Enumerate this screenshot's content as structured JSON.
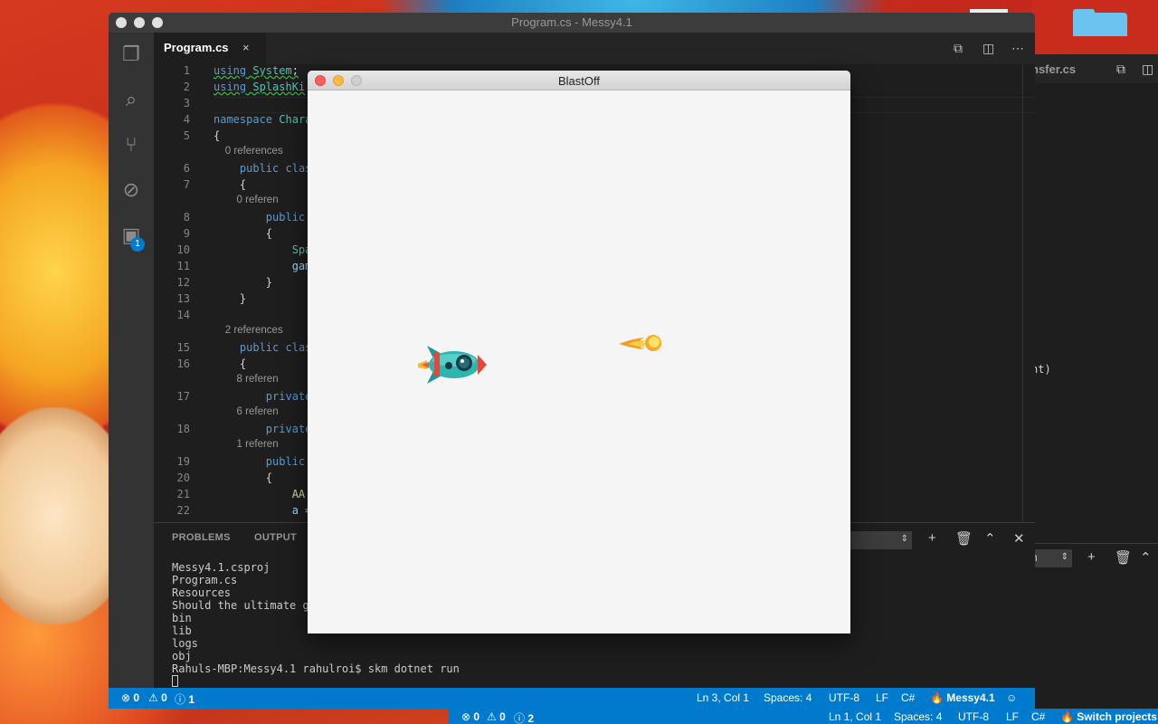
{
  "main_window": {
    "title": "Program.cs - Messy4.1",
    "tab": {
      "label": "Program.cs",
      "close": "×"
    },
    "activity_badge": "1",
    "code_lines": [
      {
        "num": "1",
        "html": "<span class=\"kw squig\">using</span><span class=\"squig\"> </span><span class=\"ty squig\">System</span><span class=\"squig\">;</span>"
      },
      {
        "num": "2",
        "html": "<span class=\"kw squig\">using</span><span class=\"squig\"> </span><span class=\"ty squig\">SplashKi</span>"
      },
      {
        "num": "3",
        "html": ""
      },
      {
        "num": "4",
        "html": "<span class=\"kw\">namespace</span> <span class=\"ty\">Chara</span>"
      },
      {
        "num": "5",
        "html": "{"
      },
      {
        "lens": true,
        "text": "    0 references"
      },
      {
        "num": "6",
        "html": "    <span class=\"kw\">public</span> <span class=\"kw\">clas</span>"
      },
      {
        "num": "7",
        "html": "    {"
      },
      {
        "lens": true,
        "text": "        0 referen"
      },
      {
        "num": "8",
        "html": "        <span class=\"kw\">public</span>"
      },
      {
        "num": "9",
        "html": "        {"
      },
      {
        "num": "10",
        "html": "            <span class=\"ty\">Spa</span>"
      },
      {
        "num": "11",
        "html": "            <span class=\"var\">gam</span>"
      },
      {
        "num": "12",
        "html": "        }"
      },
      {
        "num": "13",
        "html": "    }"
      },
      {
        "num": "14",
        "html": ""
      },
      {
        "lens": true,
        "text": "    2 references"
      },
      {
        "num": "15",
        "html": "    <span class=\"kw\">public</span> <span class=\"kw\">clas</span>"
      },
      {
        "num": "16",
        "html": "    {"
      },
      {
        "lens": true,
        "text": "        8 referen"
      },
      {
        "num": "17",
        "html": "        <span class=\"kw\">private</span>"
      },
      {
        "lens": true,
        "text": "        6 referen"
      },
      {
        "num": "18",
        "html": "        <span class=\"kw\">private</span>"
      },
      {
        "lens": true,
        "text": "        1 referen"
      },
      {
        "num": "19",
        "html": "        <span class=\"kw\">public</span>"
      },
      {
        "num": "20",
        "html": "        {"
      },
      {
        "num": "21",
        "html": "            <span class=\"fn\">AA</span>"
      },
      {
        "num": "22",
        "html": "            <span class=\"var\">a</span> ="
      }
    ],
    "panel": {
      "tabs": [
        "PROBLEMS",
        "OUTPUT"
      ],
      "terminal_lines": [
        "Messy4.1.csproj",
        "Program.cs",
        "Resources",
        "Should the ultimate g",
        "bin",
        "lib",
        "logs",
        "obj",
        "Rahuls-MBP:Messy4.1 rahulroi$ skm dotnet run"
      ]
    },
    "status": {
      "errors": "0",
      "warnings": "0",
      "info": "1",
      "position": "Ln 3, Col 1",
      "spaces": "Spaces: 4",
      "encoding": "UTF-8",
      "eol": "LF",
      "language": "C#",
      "project": "Messy4.1"
    }
  },
  "back_window": {
    "tab_label": "nsfer.cs",
    "code_fragment": "nt)",
    "select_label": "sh",
    "status": {
      "errors": "0",
      "warnings": "0",
      "info": "2",
      "position": "Ln 1, Col 1",
      "spaces": "Spaces: 4",
      "encoding": "UTF-8",
      "eol": "LF",
      "language": "C#",
      "switch": "Switch projects"
    }
  },
  "game_window": {
    "title": "BlastOff"
  },
  "colors": {
    "status_bar": "#007acc",
    "editor_bg": "#1e1e1e",
    "game_bg": "#f5f5f5"
  }
}
